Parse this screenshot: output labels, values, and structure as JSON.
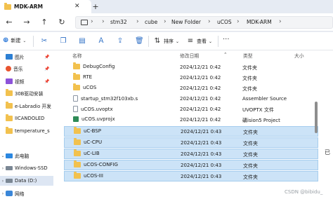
{
  "window": {
    "tab_title": "MDK-ARM",
    "tab_close": "✕",
    "new_tab": "+"
  },
  "nav": {
    "back": "←",
    "forward": "→",
    "up": "↑",
    "refresh": "↻"
  },
  "breadcrumbs": [
    "stm32",
    "cube",
    "New Folder",
    "uCOS",
    "MDK-ARM"
  ],
  "toolbar": {
    "new_label": "新建",
    "sort_label": "排序",
    "view_label": "查看",
    "more": "···"
  },
  "sidebar": {
    "quick": [
      {
        "label": "图片",
        "icon": "pictures-icon"
      },
      {
        "label": "音乐",
        "icon": "music-icon"
      },
      {
        "label": "视频",
        "icon": "videos-icon"
      },
      {
        "label": "30B驱动安装",
        "icon": "folder-icon"
      },
      {
        "label": "e-Labradio 开发",
        "icon": "folder-icon"
      },
      {
        "label": "IICANDOLED",
        "icon": "folder-icon"
      },
      {
        "label": "temperature_s",
        "icon": "folder-icon"
      }
    ],
    "this_pc": "此电脑",
    "drives": [
      {
        "label": "Windows-SSD"
      },
      {
        "label": "Data (D:)"
      }
    ],
    "network": "网络"
  },
  "columns": {
    "name": "名称",
    "modified": "修改日期",
    "type": "类型",
    "size": "大小"
  },
  "files": [
    {
      "name": "DebugConfig",
      "date": "2024/12/21 0:42",
      "type": "文件夹",
      "icon": "folder-icon",
      "selected": false
    },
    {
      "name": "RTE",
      "date": "2024/12/21 0:42",
      "type": "文件夹",
      "icon": "folder-icon",
      "selected": false
    },
    {
      "name": "uCOS",
      "date": "2024/12/21 0:42",
      "type": "文件夹",
      "icon": "folder-icon",
      "selected": false
    },
    {
      "name": "startup_stm32f103xb.s",
      "date": "2024/12/21 0:42",
      "type": "Assembler Source",
      "icon": "file-icon",
      "selected": false
    },
    {
      "name": "uCOS.uvoptx",
      "date": "2024/12/21 0:42",
      "type": "UVOPTX 文件",
      "icon": "file-icon",
      "selected": false
    },
    {
      "name": "uCOS.uvprojx",
      "date": "2024/12/21 0:42",
      "type": "礦ision5 Project",
      "icon": "project-icon",
      "selected": false
    },
    {
      "name": "uC-BSP",
      "date": "2024/12/21 0:43",
      "type": "文件夹",
      "icon": "folder-icon",
      "selected": true
    },
    {
      "name": "uC-CPU",
      "date": "2024/12/21 0:43",
      "type": "文件夹",
      "icon": "folder-icon",
      "selected": true
    },
    {
      "name": "uC-LIB",
      "date": "2024/12/21 0:43",
      "type": "文件夹",
      "icon": "folder-icon",
      "selected": true
    },
    {
      "name": "uCOS-CONFIG",
      "date": "2024/12/21 0:43",
      "type": "文件夹",
      "icon": "folder-icon",
      "selected": true
    },
    {
      "name": "uCOS-III",
      "date": "2024/12/21 0:43",
      "type": "文件夹",
      "icon": "folder-icon",
      "selected": true
    }
  ],
  "edge_text": "已",
  "watermark": "CSDN @bibidu_"
}
